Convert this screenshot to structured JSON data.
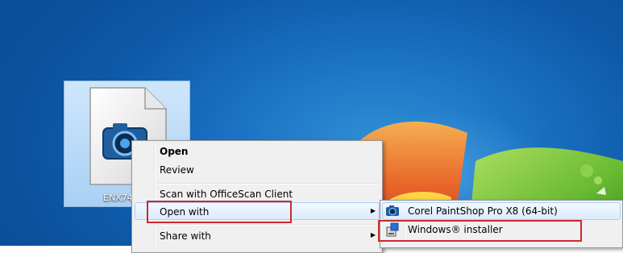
{
  "desktop": {
    "file_icon": {
      "label": "ENX74Upd"
    }
  },
  "context_menu": {
    "items": [
      {
        "label": "Open",
        "bold": true
      },
      {
        "label": "Review"
      },
      {
        "label": "Scan with OfficeScan Client"
      },
      {
        "label": "Open with",
        "has_submenu": true
      },
      {
        "label": "Share with",
        "has_submenu": true
      }
    ]
  },
  "open_with_submenu": {
    "items": [
      {
        "label": "Corel PaintShop Pro X8 (64-bit)",
        "icon": "paintshop-icon"
      },
      {
        "label": "Windows® installer",
        "icon": "windows-installer-icon"
      }
    ]
  },
  "colors": {
    "highlight_box": "#d0272f",
    "desktop_blue": "#1a6fc1"
  }
}
